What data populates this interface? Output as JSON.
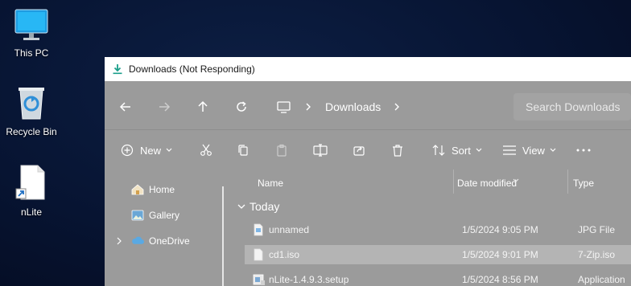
{
  "desktop": {
    "icons": [
      {
        "label": "This PC",
        "icon": "monitor-icon"
      },
      {
        "label": "Recycle Bin",
        "icon": "recycle-bin-icon"
      },
      {
        "label": "nLite",
        "icon": "shortcut-file-icon"
      }
    ]
  },
  "window": {
    "title": "Downloads (Not Responding)",
    "title_icon": "download-icon",
    "breadcrumb": [
      "Downloads"
    ],
    "search_placeholder": "Search Downloads"
  },
  "toolbar": {
    "new_label": "New",
    "sort_label": "Sort",
    "view_label": "View"
  },
  "nav_pane": {
    "items": [
      {
        "label": "Home",
        "icon": "home-icon"
      },
      {
        "label": "Gallery",
        "icon": "gallery-icon"
      },
      {
        "label": "OneDrive",
        "icon": "cloud-icon"
      }
    ]
  },
  "file_list": {
    "columns": [
      "Name",
      "Date modified",
      "Type"
    ],
    "group_label": "Today",
    "rows": [
      {
        "name": "unnamed",
        "date": "1/5/2024 9:05 PM",
        "type": "JPG File",
        "selected": false
      },
      {
        "name": "cd1.iso",
        "date": "1/5/2024 9:01 PM",
        "type": "7-Zip.iso",
        "selected": true
      },
      {
        "name": "nLite-1.4.9.3.setup",
        "date": "1/5/2024 8:56 PM",
        "type": "Application",
        "selected": false
      }
    ]
  },
  "colors": {
    "desktop_bg": "#071432",
    "frozen_overlay": "#9b9b9b",
    "selection": "#b4b4b4"
  }
}
